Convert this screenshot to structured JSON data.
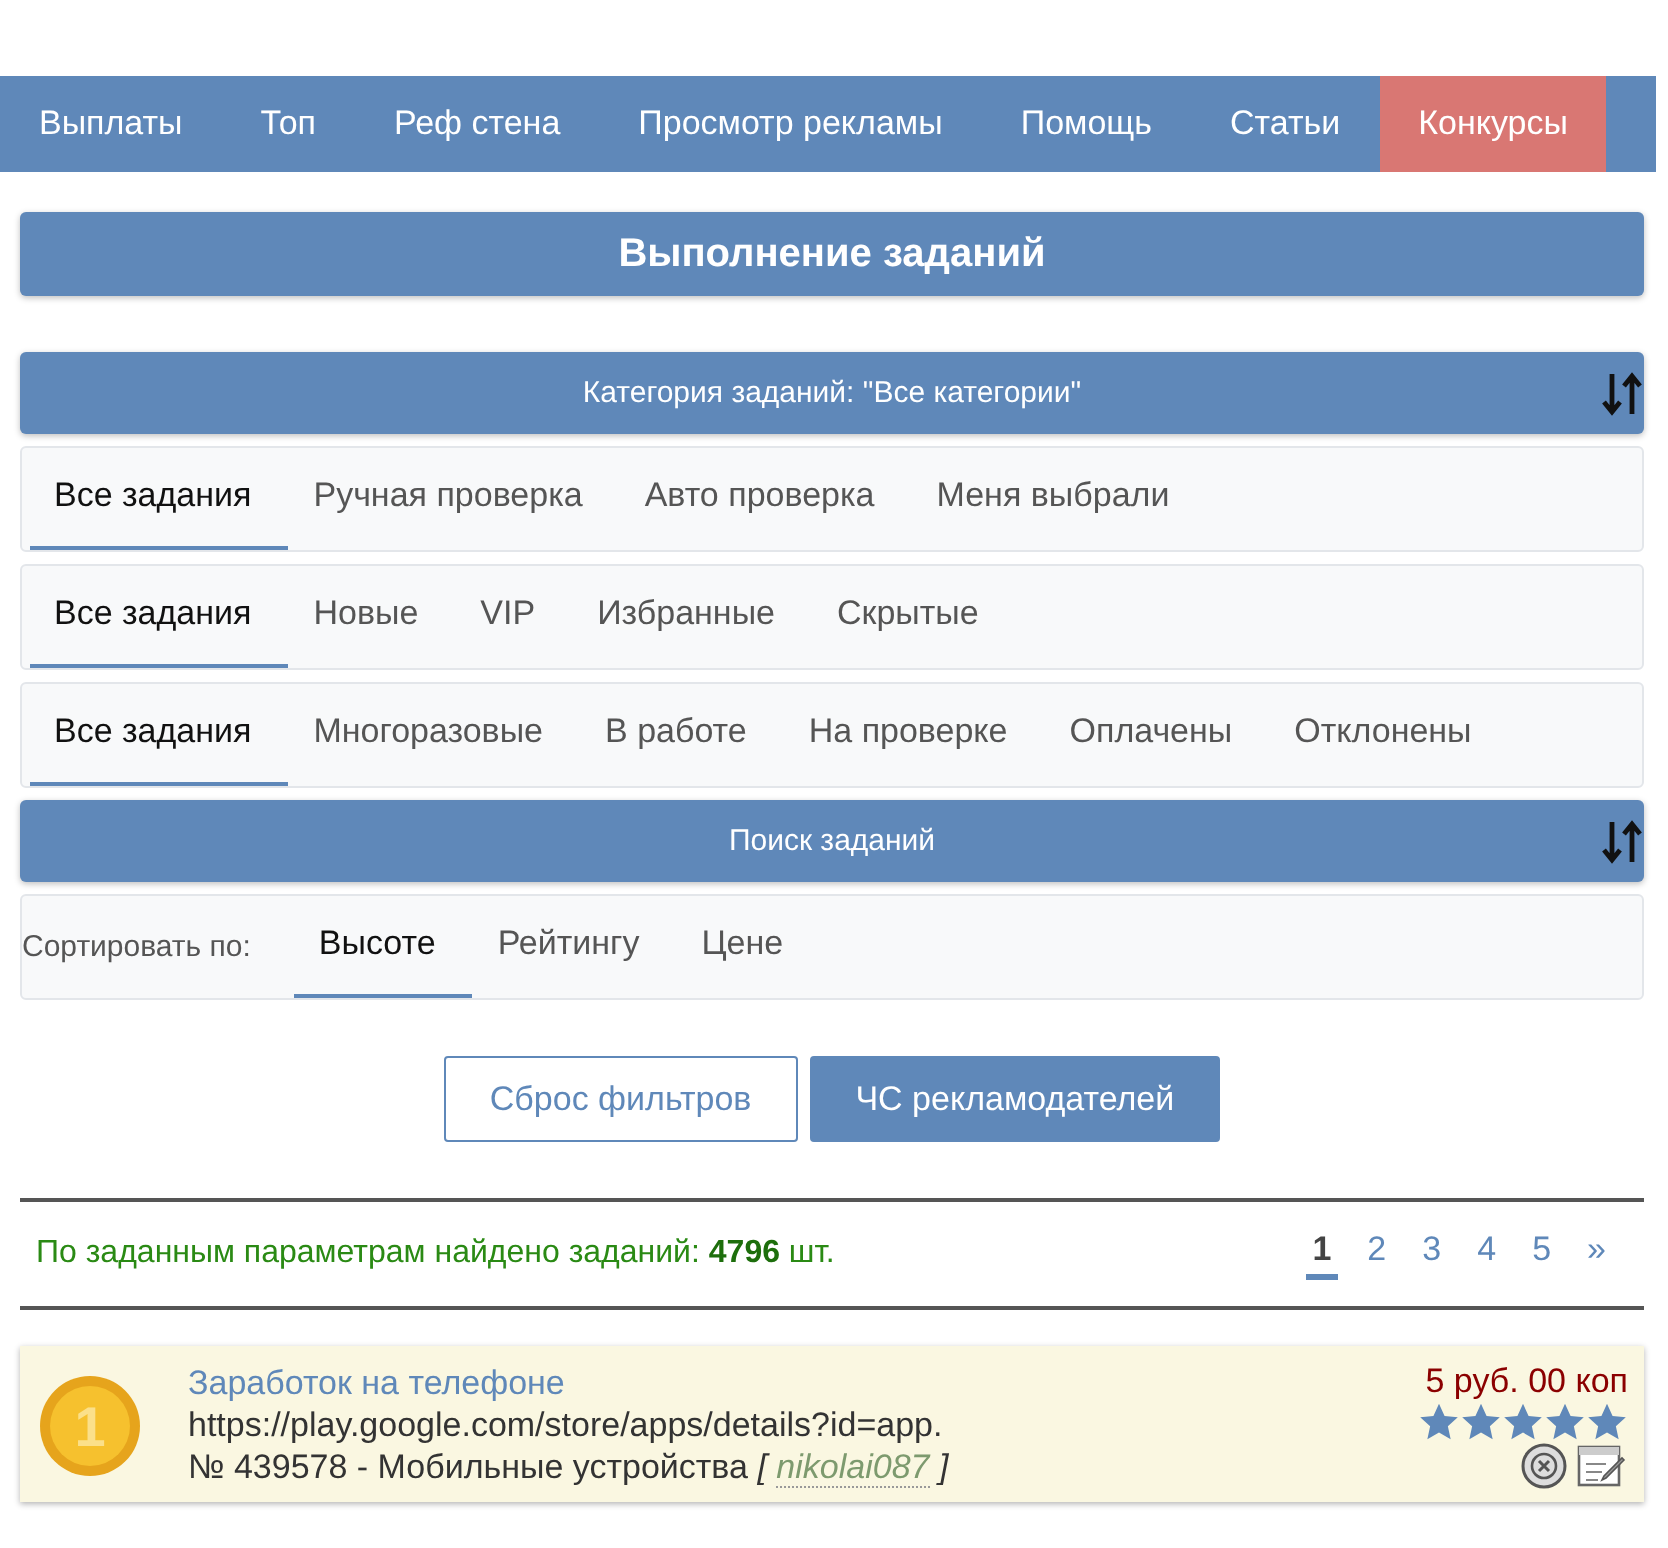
{
  "nav": [
    {
      "label": "Выплаты",
      "selected": false
    },
    {
      "label": "Топ",
      "selected": false
    },
    {
      "label": "Реф стена",
      "selected": false
    },
    {
      "label": "Просмотр рекламы",
      "selected": false
    },
    {
      "label": "Помощь",
      "selected": false
    },
    {
      "label": "Статьи",
      "selected": false
    },
    {
      "label": "Конкурсы",
      "selected": true
    }
  ],
  "page_title": "Выполнение заданий",
  "category_header": "Категория заданий: \"Все категории\"",
  "tab_rows": [
    {
      "tabs": [
        {
          "label": "Все задания",
          "selected": true
        },
        {
          "label": "Ручная проверка",
          "selected": false
        },
        {
          "label": "Авто проверка",
          "selected": false
        },
        {
          "label": "Меня выбрали",
          "selected": false
        }
      ]
    },
    {
      "tabs": [
        {
          "label": "Все задания",
          "selected": true
        },
        {
          "label": "Новые",
          "selected": false
        },
        {
          "label": "VIP",
          "selected": false
        },
        {
          "label": "Избранные",
          "selected": false
        },
        {
          "label": "Скрытые",
          "selected": false
        }
      ]
    },
    {
      "tabs": [
        {
          "label": "Все задания",
          "selected": true
        },
        {
          "label": "Многоразовые",
          "selected": false
        },
        {
          "label": "В работе",
          "selected": false
        },
        {
          "label": "На проверке",
          "selected": false
        },
        {
          "label": "Оплачены",
          "selected": false
        },
        {
          "label": "Отклонены",
          "selected": false
        }
      ]
    }
  ],
  "search_header": "Поиск заданий",
  "sort": {
    "label": "Сортировать по:",
    "options": [
      {
        "label": "Высоте",
        "selected": true
      },
      {
        "label": "Рейтингу",
        "selected": false
      },
      {
        "label": "Цене",
        "selected": false
      }
    ]
  },
  "buttons": [
    {
      "label": "Сброс фильтров",
      "kind": "outline"
    },
    {
      "label": "ЧС рекламодателей",
      "kind": "filled"
    }
  ],
  "results": {
    "text": "По заданным параметрам найдено заданий: **4796** шт."
  },
  "pages": [
    {
      "label": "1",
      "selected": true
    },
    {
      "label": "2",
      "selected": false
    },
    {
      "label": "3",
      "selected": false
    },
    {
      "label": "4",
      "selected": false
    },
    {
      "label": "5",
      "selected": false
    },
    {
      "label": "»",
      "selected": false
    }
  ],
  "tasks": [
    {
      "rank": "1",
      "title": "Заработок на телефоне",
      "url": "https://play.google.com/store/apps/details?id=app.",
      "meta": "№ 439578 - Мобильные устройства",
      "bracket_open": "[",
      "author": "nikolai087",
      "bracket_close": "]",
      "price": "5 руб. 00 коп",
      "stars": 5
    }
  ]
}
